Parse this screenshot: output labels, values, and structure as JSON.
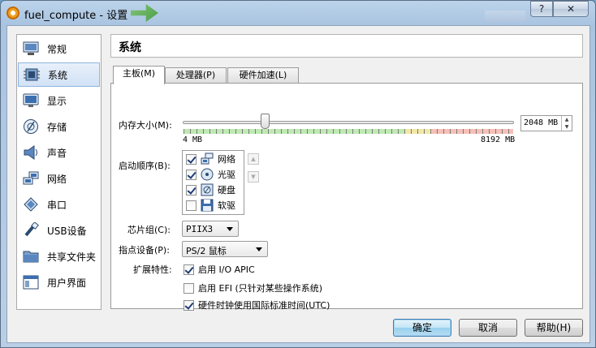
{
  "window": {
    "title": "fuel_compute - 设置",
    "help_label": "?",
    "close_label": "✕"
  },
  "sidebar": {
    "selected_index": 1,
    "items": [
      {
        "label": "常规",
        "icon": "general-icon"
      },
      {
        "label": "系统",
        "icon": "system-icon"
      },
      {
        "label": "显示",
        "icon": "display-icon"
      },
      {
        "label": "存储",
        "icon": "storage-icon"
      },
      {
        "label": "声音",
        "icon": "sound-icon"
      },
      {
        "label": "网络",
        "icon": "network-icon"
      },
      {
        "label": "串口",
        "icon": "serial-port-icon"
      },
      {
        "label": "USB设备",
        "icon": "usb-icon"
      },
      {
        "label": "共享文件夹",
        "icon": "shared-folder-icon"
      },
      {
        "label": "用户界面",
        "icon": "user-interface-icon"
      }
    ]
  },
  "header": {
    "title": "系统"
  },
  "tabs": [
    {
      "label": "主板(M)",
      "active": true
    },
    {
      "label": "处理器(P)",
      "active": false
    },
    {
      "label": "硬件加速(L)",
      "active": false
    }
  ],
  "motherboard": {
    "memory": {
      "label": "内存大小(M):",
      "min_label": "4 MB",
      "max_label": "8192 MB",
      "value": "2048 MB",
      "value_mb": 2048,
      "min_mb": 4,
      "max_mb": 8192
    },
    "boot_order": {
      "label": "启动顺序(B):",
      "items": [
        {
          "label": "网络",
          "checked": true,
          "icon": "network-boot-icon"
        },
        {
          "label": "光驱",
          "checked": true,
          "icon": "optical-drive-icon"
        },
        {
          "label": "硬盘",
          "checked": true,
          "icon": "hard-disk-icon"
        },
        {
          "label": "软驱",
          "checked": false,
          "icon": "floppy-icon"
        }
      ],
      "up_symbol": "▲",
      "down_symbol": "▼"
    },
    "chipset": {
      "label": "芯片组(C):",
      "value": "PIIX3"
    },
    "pointing_device": {
      "label": "指点设备(P):",
      "value": "PS/2 鼠标"
    },
    "extended_features": {
      "label": "扩展特性:",
      "options": [
        {
          "label": "启用 I/O APIC",
          "checked": true
        },
        {
          "label": "启用 EFI (只针对某些操作系统)",
          "checked": false
        },
        {
          "label": "硬件时钟使用国际标准时间(UTC)",
          "checked": true
        }
      ]
    }
  },
  "buttons": {
    "ok": "确定",
    "cancel": "取消",
    "help": "帮助(H)"
  }
}
